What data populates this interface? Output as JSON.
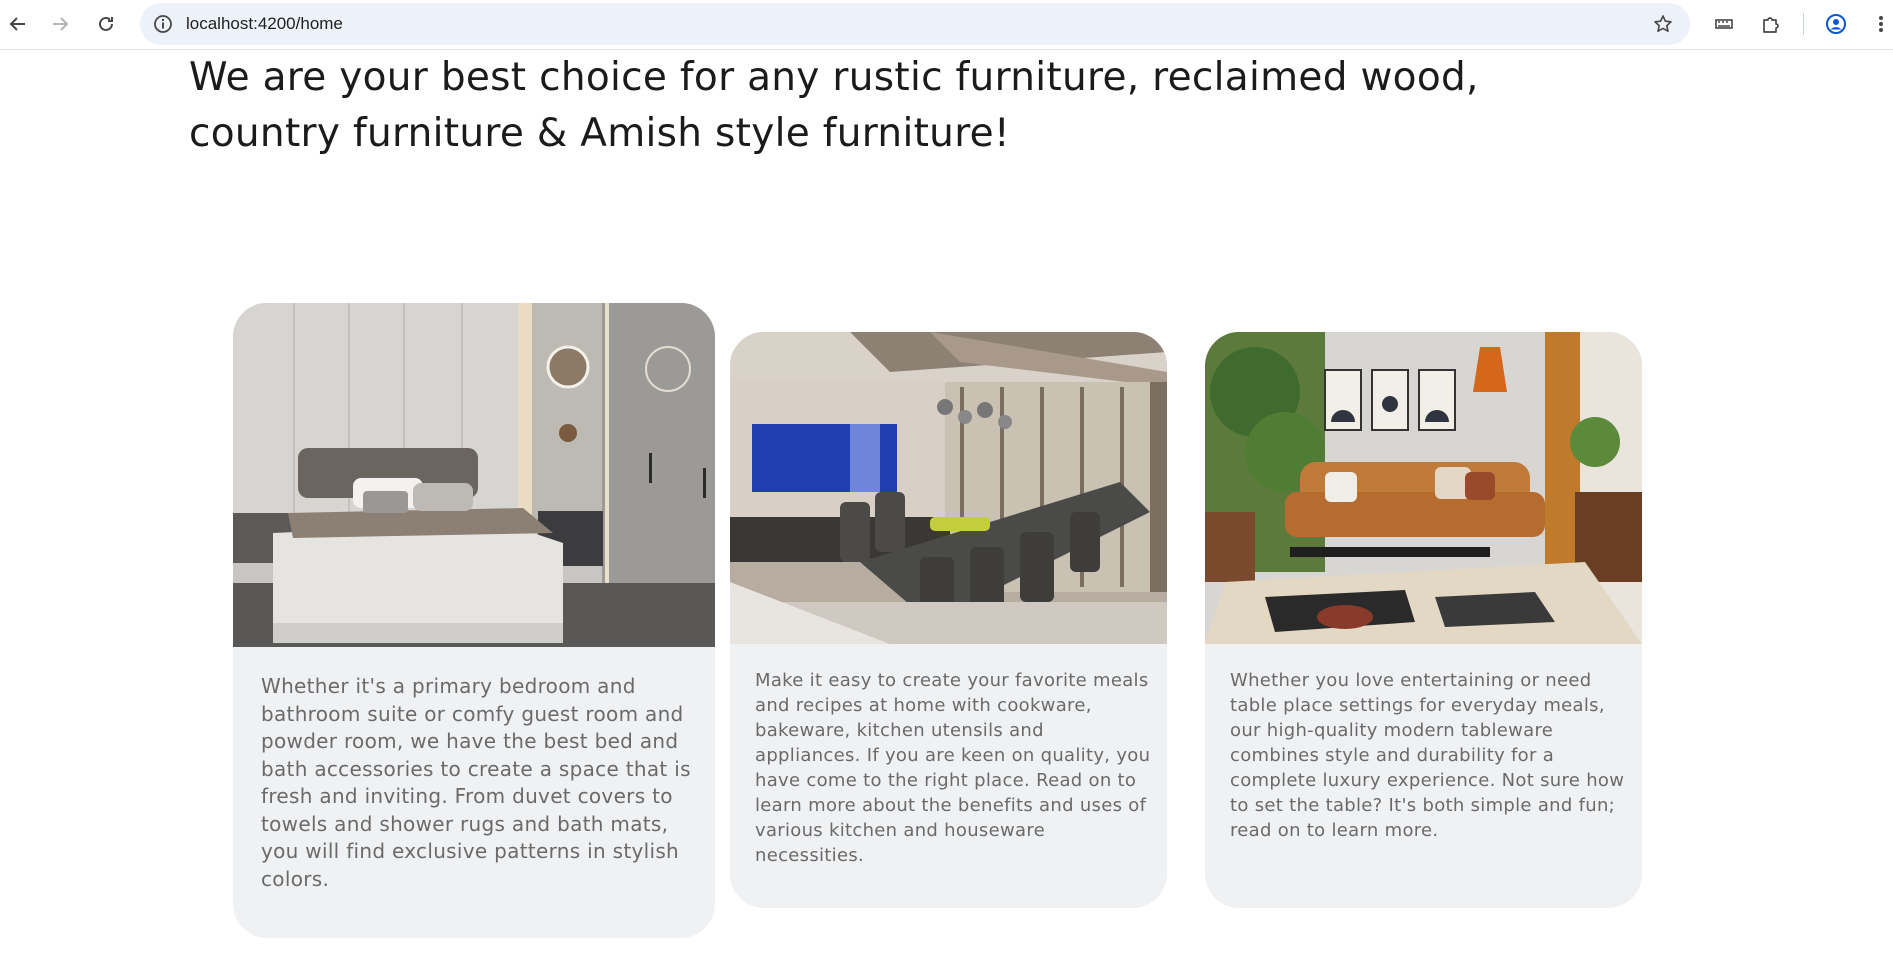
{
  "browser": {
    "url": "localhost:4200/home",
    "icons": [
      "back-arrow-icon",
      "forward-arrow-icon",
      "reload-icon",
      "site-info-icon",
      "bookmark-star-icon",
      "media-icon",
      "extensions-puzzle-icon",
      "profile-avatar-icon",
      "more-menu-icon"
    ]
  },
  "page": {
    "headline": "We are your best choice for any rustic furniture, reclaimed wood, country furniture & Amish style furniture!",
    "cards": [
      {
        "image": "bedroom-photo",
        "text": "Whether it's a primary bedroom and bathroom suite or comfy guest room and powder room, we have the best bed and bath accessories to create a space that is fresh and inviting. From duvet covers to towels and shower rugs and bath mats, you will find exclusive patterns in stylish colors."
      },
      {
        "image": "dining-room-photo",
        "text": "Make it easy to create your favorite meals and recipes at home with cookware, bakeware, kitchen utensils and appliances. If you are keen on quality, you have come to the right place. Read on to learn more about the benefits and uses of various kitchen and houseware necessities."
      },
      {
        "image": "living-room-photo",
        "text": "Whether you love entertaining or need table place settings for everyday meals, our high-quality modern tableware combines style and durability for a complete luxury experience. Not sure how to set the table? It's both simple and fun; read on to learn more."
      }
    ]
  },
  "colors": {
    "card_background": "#f0f1f3",
    "card_text": "#6a6a6a",
    "headline_text": "#1b1b1b",
    "omnibox_background": "#edf2fa"
  }
}
